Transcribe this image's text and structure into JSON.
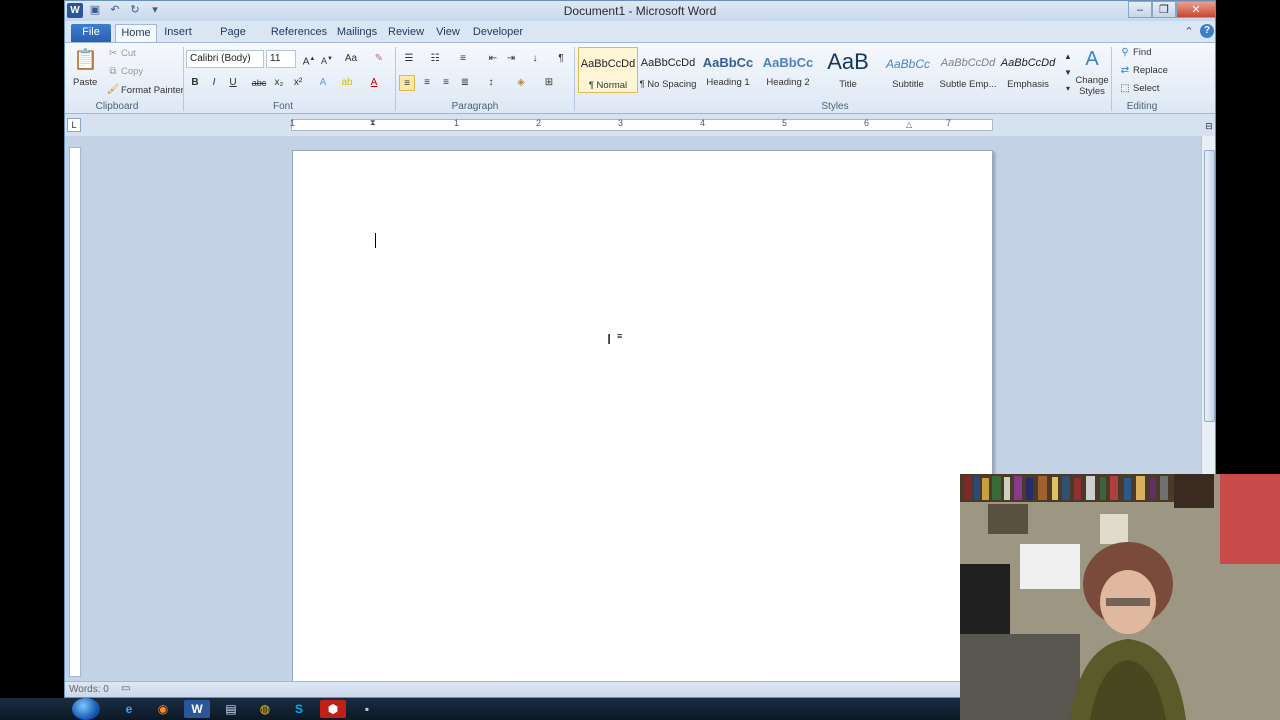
{
  "window": {
    "title": "Document1 - Microsoft Word"
  },
  "tabs": [
    "File",
    "Home",
    "Insert",
    "Page Layout",
    "References",
    "Mailings",
    "Review",
    "View",
    "Developer"
  ],
  "ribbon": {
    "clipboard": {
      "paste": "Paste",
      "cut": "Cut",
      "copy": "Copy",
      "format_painter": "Format Painter",
      "group": "Clipboard"
    },
    "font": {
      "font_name": "Calibri (Body)",
      "font_size": "11",
      "bold": "B",
      "italic": "I",
      "underline": "U",
      "strike": "abc",
      "subscript": "x₂",
      "superscript": "x²",
      "font_color": "A",
      "group": "Font"
    },
    "paragraph": {
      "group": "Paragraph",
      "pilcrow": "¶"
    },
    "styles": {
      "group": "Styles",
      "items": [
        {
          "sample": "AaBbCcDd",
          "name": "¶ Normal"
        },
        {
          "sample": "AaBbCcDd",
          "name": "¶ No Spacing"
        },
        {
          "sample": "AaBbCc",
          "name": "Heading 1"
        },
        {
          "sample": "AaBbCc",
          "name": "Heading 2"
        },
        {
          "sample": "AaB",
          "name": "Title"
        },
        {
          "sample": "AaBbCc",
          "name": "Subtitle"
        },
        {
          "sample": "AaBbCcDd",
          "name": "Subtle Emp..."
        },
        {
          "sample": "AaBbCcDd",
          "name": "Emphasis"
        }
      ],
      "change_styles": "Change Styles"
    },
    "editing": {
      "find": "Find",
      "replace": "Replace",
      "select": "Select",
      "group": "Editing"
    }
  },
  "ruler": {
    "numbers": [
      "1",
      "2",
      "3",
      "4",
      "5",
      "6",
      "7"
    ]
  },
  "status": {
    "words": "Words: 0"
  },
  "accent_color": "#2b579a"
}
